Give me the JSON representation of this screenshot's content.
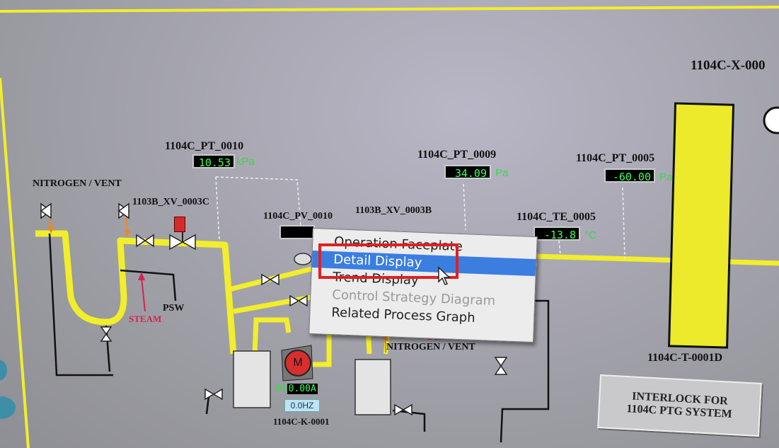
{
  "header": {
    "equipment_title": "1104C-X-000"
  },
  "instruments": {
    "pt_0010": {
      "tag": "1104C_PT_0010",
      "value": "10.53",
      "unit": "kPa"
    },
    "pt_0009": {
      "tag": "1104C_PT_0009",
      "value": "34.09",
      "unit": "Pa"
    },
    "pt_0005": {
      "tag": "1104C_PT_0005",
      "value": "-60.00",
      "unit": "Pa"
    },
    "te_0005": {
      "tag": "1104C_TE_0005",
      "value": "-13.8",
      "unit": "°C"
    },
    "pv_0010": {
      "tag": "1104C_PV_0010"
    }
  },
  "valves": {
    "xv_0003c": "1103B_XV_0003C",
    "xv_0003b": "1103B_XV_0003B"
  },
  "labels": {
    "nitrogen_vent_left": "NITROGEN / VENT",
    "nitrogen_vent_mid": "NITROGEN / VENT",
    "steam_left": "STEAM",
    "steam_mid": "STEAM",
    "psw": "PSW"
  },
  "equipment": {
    "compressor_tag": "1104C-K-0001",
    "motor_label": "M",
    "motor_bq_prefix": "BQ",
    "motor_bq_value": "0.00A",
    "motor_hz": "0.0HZ",
    "tank_tag": "1104C-T-0001D",
    "tank_level": 0.93
  },
  "interlock": {
    "line1": "INTERLOCK FOR",
    "line2": "1104C PTG SYSTEM"
  },
  "context_menu": {
    "items": [
      {
        "label": "Operation Faceplate",
        "state": "normal"
      },
      {
        "label": "Detail Display",
        "state": "selected"
      },
      {
        "label": "Trend Display",
        "state": "normal"
      },
      {
        "label": "Control Strategy Diagram",
        "state": "disabled"
      },
      {
        "label": "Related Process Graph",
        "state": "normal"
      }
    ]
  },
  "colors": {
    "pipe": "#f2ee2b",
    "background": "#a4a4ac",
    "menu_selection": "#3b7ee0",
    "highlight_box": "#e02020",
    "value_text": "#3cff5a"
  }
}
